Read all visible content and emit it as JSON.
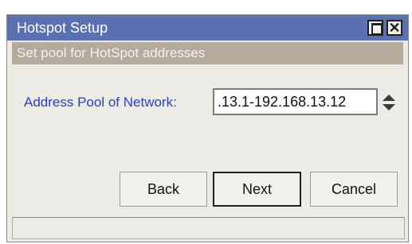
{
  "window": {
    "title": "Hotspot Setup"
  },
  "header": {
    "subtitle": "Set pool for HotSpot addresses"
  },
  "form": {
    "address_pool_label": "Address Pool of Network:",
    "address_pool_value": ".13.1-192.168.13.12"
  },
  "buttons": {
    "back_label": "Back",
    "next_label": "Next",
    "cancel_label": "Cancel"
  },
  "icons": {
    "maximize": "maximize-icon",
    "close": "close-icon",
    "spinner": "up-down-arrows-icon"
  },
  "colors": {
    "titlebar": "#5b6fb3",
    "label_text": "#2b3fc7",
    "subtitle_bar": "#b4ab9d"
  }
}
